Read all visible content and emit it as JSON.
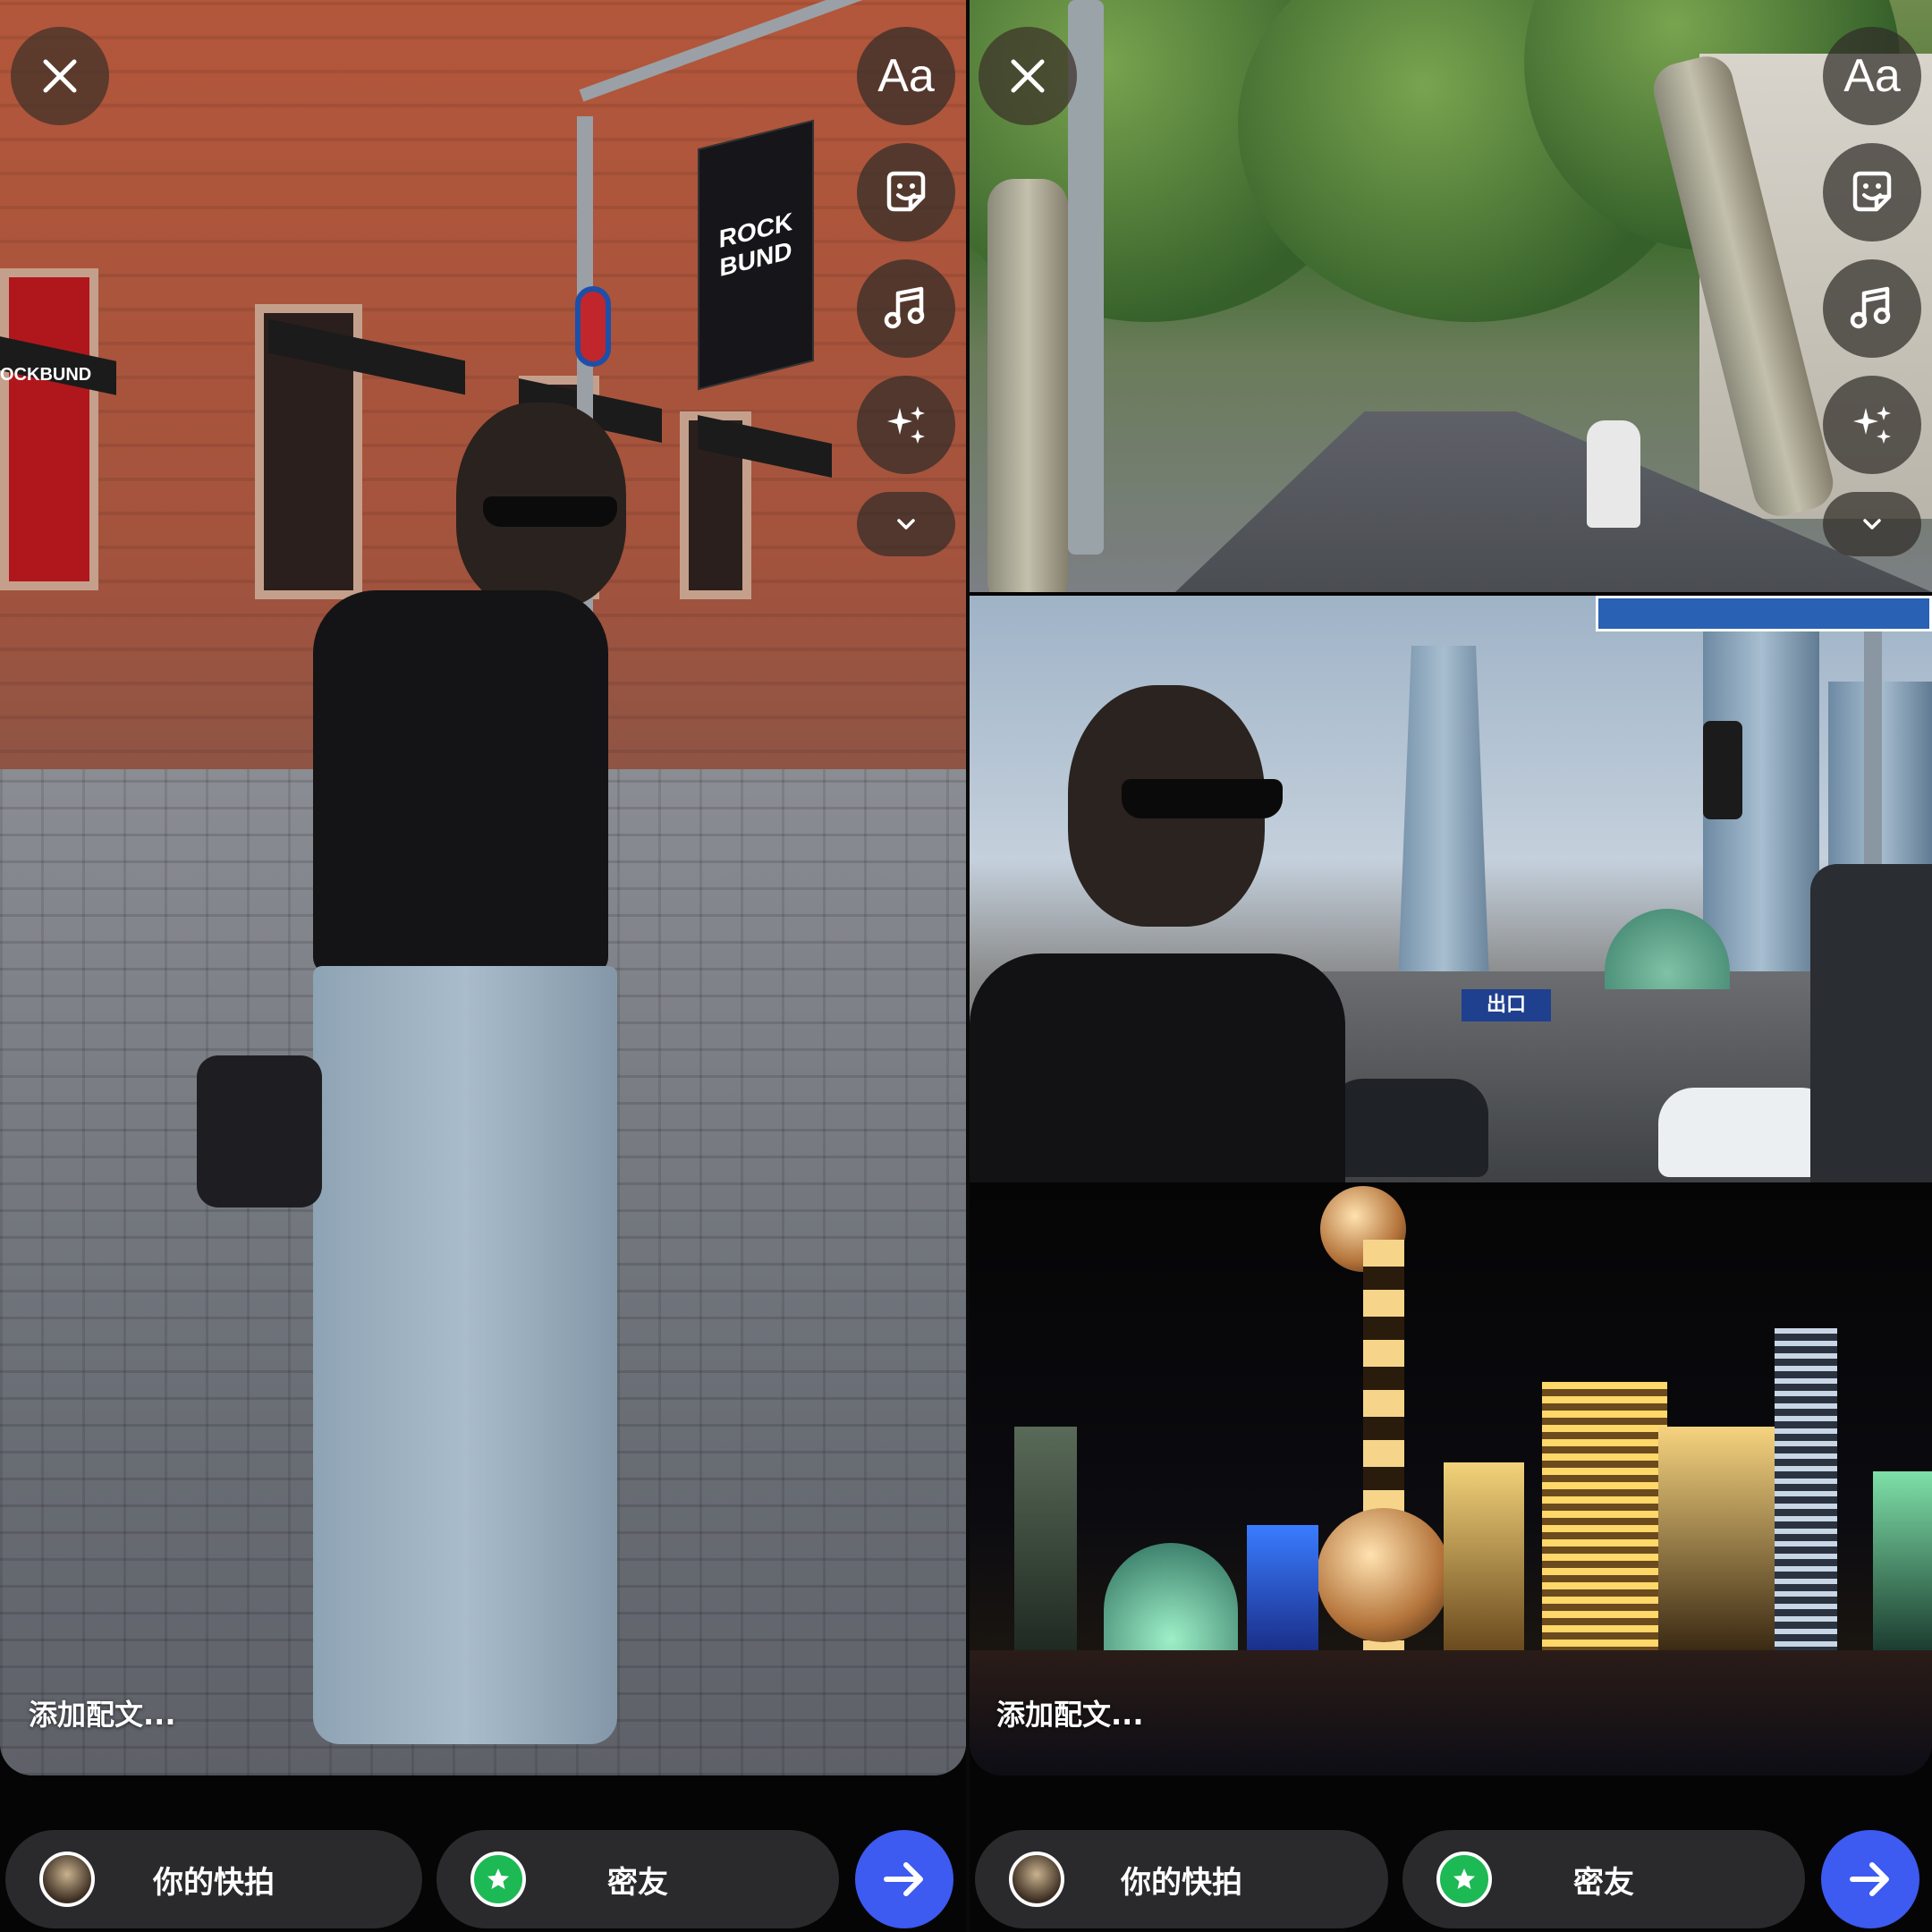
{
  "left": {
    "caption": "添加配文...",
    "tools": {
      "text_label": "Aa"
    },
    "story_button": "你的快拍",
    "friends_button": "密友"
  },
  "right": {
    "caption": "添加配文...",
    "tools": {
      "text_label": "Aa"
    },
    "story_button": "你的快拍",
    "friends_button": "密友",
    "exit_sign": "出口"
  },
  "photo_text": {
    "flag": "ROCK BUND",
    "storefront": "OCKBUND"
  },
  "icons": [
    "close-icon",
    "sticker-icon",
    "music-icon",
    "sparkle-effects-icon",
    "chevron-down-icon",
    "star-icon",
    "arrow-right-icon"
  ],
  "colors": {
    "send_button": "#3d5af1",
    "close_friends": "#1db954",
    "pill_bg": "#2a2a2c"
  }
}
